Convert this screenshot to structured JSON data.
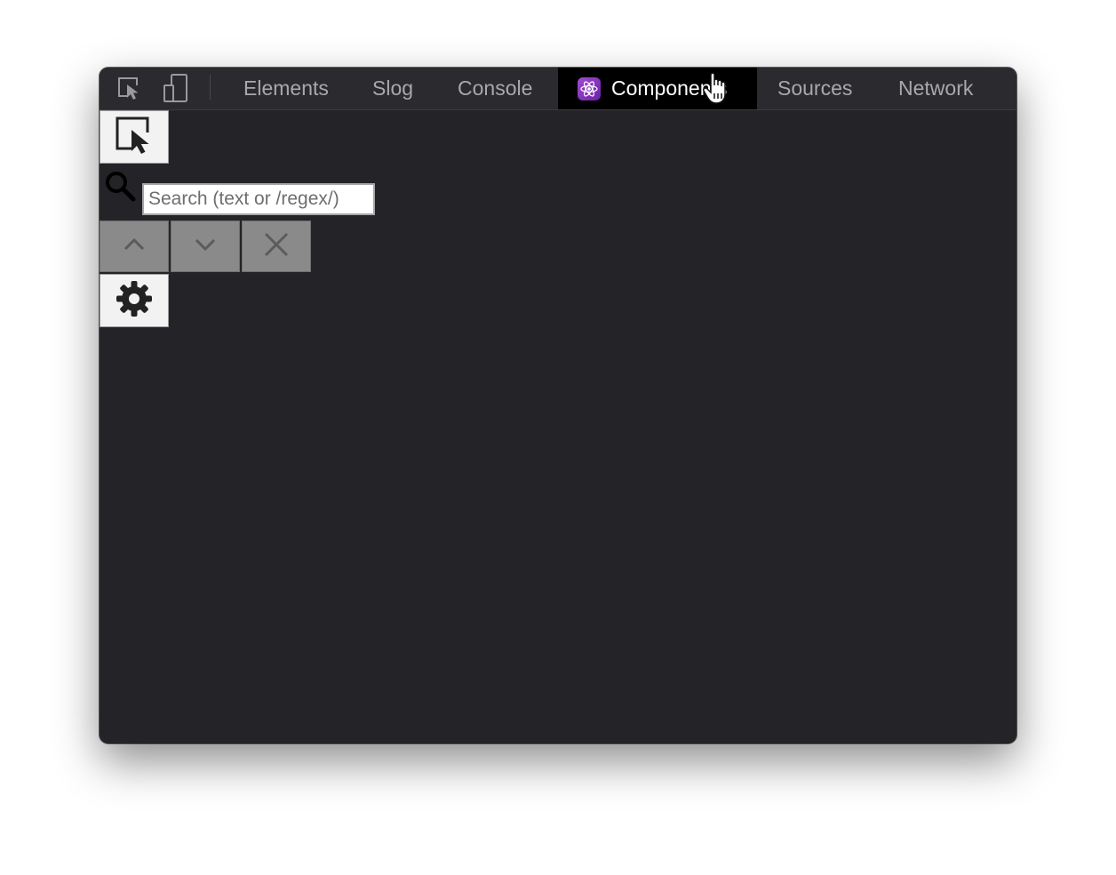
{
  "toolbar": {
    "tabs": [
      {
        "label": "Elements"
      },
      {
        "label": "Slog"
      },
      {
        "label": "Console"
      },
      {
        "label": "Components",
        "active": true
      },
      {
        "label": "Sources"
      },
      {
        "label": "Network"
      }
    ]
  },
  "search": {
    "placeholder": "Search (text or /regex/)",
    "value": ""
  },
  "icons": {
    "inspect": "inspect-element-icon",
    "device": "device-toggle-icon",
    "react": "react-logo-icon",
    "select": "select-element-icon",
    "search": "search-icon",
    "prev": "chevron-up-icon",
    "next": "chevron-down-icon",
    "close": "close-icon",
    "settings": "gear-icon"
  },
  "colors": {
    "panel_bg": "#242327",
    "tab_active_bg": "#000000",
    "tab_text": "#a9a8ad",
    "react_accent": "#a24cd1"
  }
}
